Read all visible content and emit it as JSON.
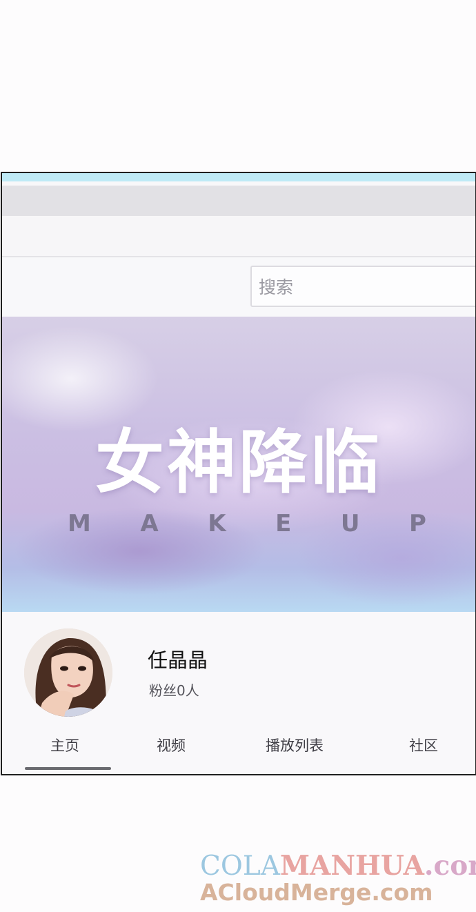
{
  "search": {
    "placeholder": "搜索"
  },
  "banner": {
    "title": "女神降临",
    "subtitle_letters": [
      "M",
      "A",
      "K",
      "E",
      "U",
      "P"
    ]
  },
  "channel": {
    "name": "任晶晶",
    "fans": "粉丝0人"
  },
  "tabs": [
    {
      "label": "主页",
      "active": true
    },
    {
      "label": "视频"
    },
    {
      "label": "播放列表"
    },
    {
      "label": "社区"
    }
  ],
  "watermark": {
    "line1_part1": "COLA",
    "line1_part2": "MANHUA",
    "line1_part3": ".com",
    "line2": "ACloudMerge.com"
  },
  "colors": {
    "accent": "#bfeaf6",
    "tab_underline": "#6a6a6f"
  }
}
